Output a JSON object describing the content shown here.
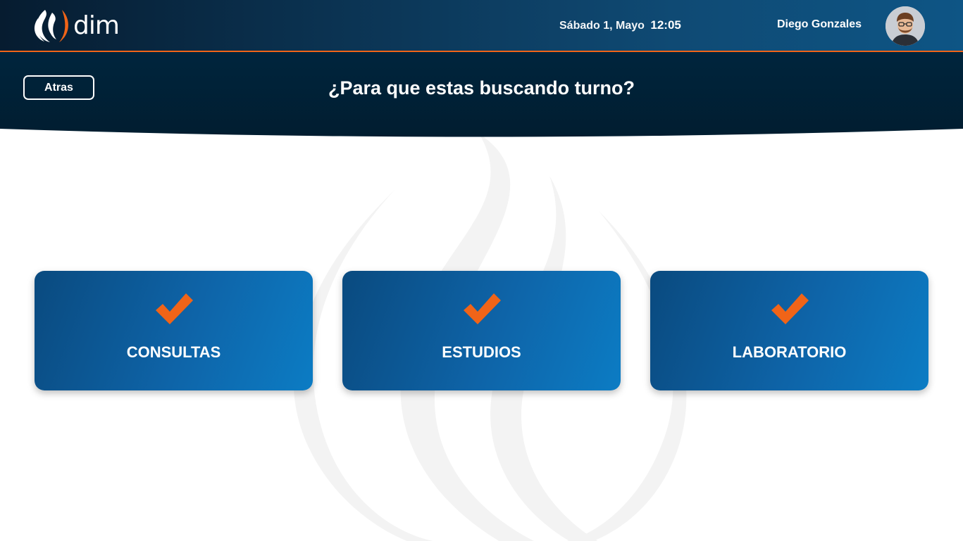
{
  "app": {
    "logo_text": "dim"
  },
  "header": {
    "date": "Sábado 1, Mayo",
    "time": "12:05",
    "user_name": "Diego Gonzales"
  },
  "page": {
    "back_label": "Atras",
    "title": "¿Para que estas buscando turno?"
  },
  "options": [
    {
      "label": "CONSULTAS",
      "icon": "check-icon"
    },
    {
      "label": "ESTUDIOS",
      "icon": "check-icon"
    },
    {
      "label": "LABORATORIO",
      "icon": "check-icon"
    }
  ],
  "colors": {
    "accent": "#f06418",
    "header_dark": "#061c30",
    "card_blue": "#0e64a8"
  }
}
